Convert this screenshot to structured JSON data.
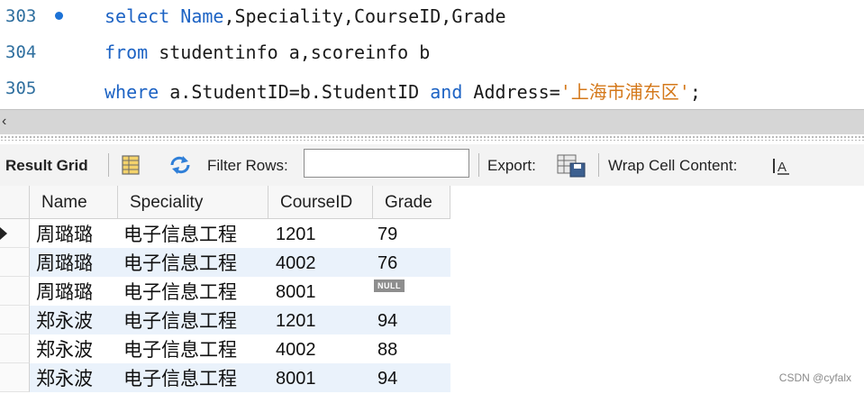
{
  "editor": {
    "lines": [
      {
        "num": "303",
        "has_breakpoint": true,
        "parts": [
          {
            "t": "select",
            "k": "kw"
          },
          {
            "t": " "
          },
          {
            "t": "Name",
            "k": "kw"
          },
          {
            "t": ",Speciality,CourseID,Grade"
          }
        ]
      },
      {
        "num": "304",
        "has_breakpoint": false,
        "parts": [
          {
            "t": "from",
            "k": "kw"
          },
          {
            "t": " studentinfo a,scoreinfo b"
          }
        ]
      },
      {
        "num": "305",
        "has_breakpoint": false,
        "parts": [
          {
            "t": "where",
            "k": "kw"
          },
          {
            "t": " a.StudentID=b.StudentID "
          },
          {
            "t": "and",
            "k": "kw"
          },
          {
            "t": " Address="
          },
          {
            "t": "'上海市浦东区'",
            "k": "str"
          },
          {
            "t": ";"
          }
        ]
      }
    ]
  },
  "toolbar": {
    "result_grid_label": "Result Grid",
    "filter_rows_label": "Filter Rows:",
    "filter_value": "",
    "export_label": "Export:",
    "wrap_label": "Wrap Cell Content:"
  },
  "grid": {
    "columns": [
      "Name",
      "Speciality",
      "CourseID",
      "Grade"
    ],
    "rows": [
      [
        "周璐璐",
        "电子信息工程",
        "1201",
        "79"
      ],
      [
        "周璐璐",
        "电子信息工程",
        "4002",
        "76"
      ],
      [
        "周璐璐",
        "电子信息工程",
        "8001",
        "NULL"
      ],
      [
        "郑永波",
        "电子信息工程",
        "1201",
        "94"
      ],
      [
        "郑永波",
        "电子信息工程",
        "4002",
        "88"
      ],
      [
        "郑永波",
        "电子信息工程",
        "8001",
        "94"
      ]
    ]
  },
  "watermark": "CSDN @cyfalx",
  "colors": {
    "keyword": "#1d63c4",
    "string": "#d4781a",
    "line_number": "#2f6f9f",
    "alt_row": "#eaf2fb"
  }
}
